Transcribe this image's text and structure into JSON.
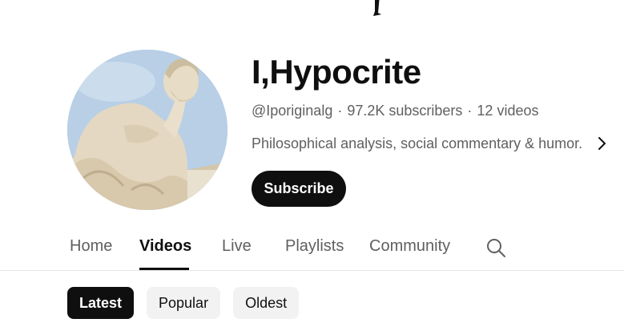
{
  "channel": {
    "name": "I,Hypocrite",
    "handle": "@Iporiginalg",
    "subscribers": "97.2K subscribers",
    "videos": "12 videos",
    "separator": "·",
    "description": "Philosophical analysis, social commentary & humor.",
    "subscribe_label": "Subscribe"
  },
  "tabs": [
    {
      "label": "Home",
      "active": false
    },
    {
      "label": "Videos",
      "active": true
    },
    {
      "label": "Live",
      "active": false
    },
    {
      "label": "Playlists",
      "active": false
    },
    {
      "label": "Community",
      "active": false
    }
  ],
  "filters": [
    {
      "label": "Latest",
      "selected": true
    },
    {
      "label": "Popular",
      "selected": false
    },
    {
      "label": "Oldest",
      "selected": false
    }
  ],
  "icons": {
    "avatar": "statue-thinker-avatar",
    "more": "chevron-right-icon",
    "search": "search-icon"
  },
  "colors": {
    "primary_text": "#0f0f0f",
    "secondary_text": "#606060",
    "chip_bg": "#f2f2f2",
    "divider": "#e5e5e5"
  }
}
